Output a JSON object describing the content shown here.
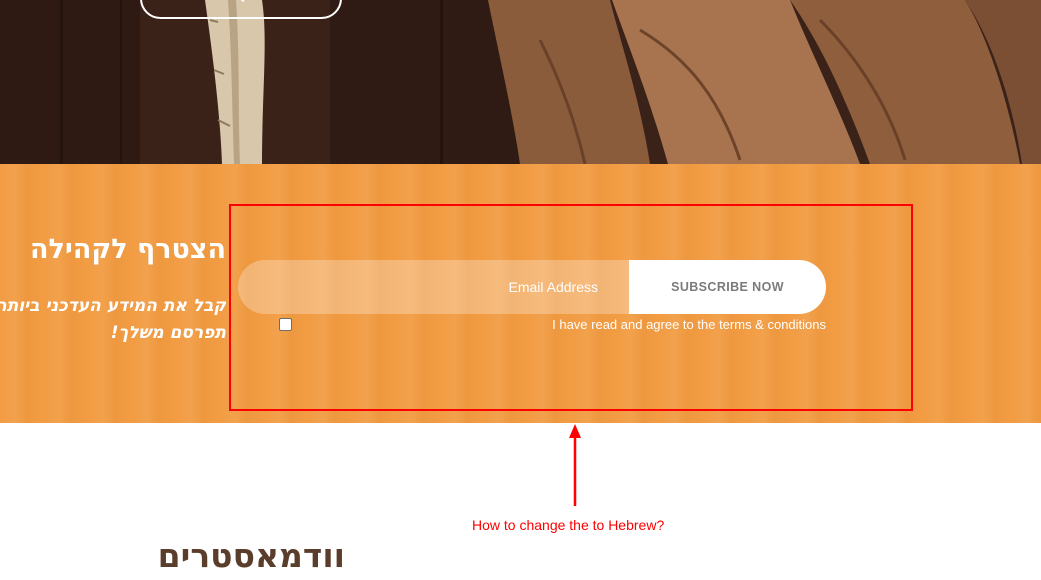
{
  "hero": {
    "image": "wooden-handle-and-leather-gloves"
  },
  "newsletter": {
    "title": "הצטרף לקהילה",
    "subtitle_line1": "קבל את המידע העדכני ביותר",
    "subtitle_line2": "תפרסם משלך!",
    "email_placeholder": "Email Address",
    "subscribe_label": "SUBSCRIBE NOW",
    "terms_label": "I have read and agree to the terms & conditions",
    "background_color": "#f29c43"
  },
  "annotation": {
    "note": "How to change the to Hebrew?",
    "color": "#ff0000"
  },
  "section": {
    "heading": "וודמאסטרים"
  }
}
